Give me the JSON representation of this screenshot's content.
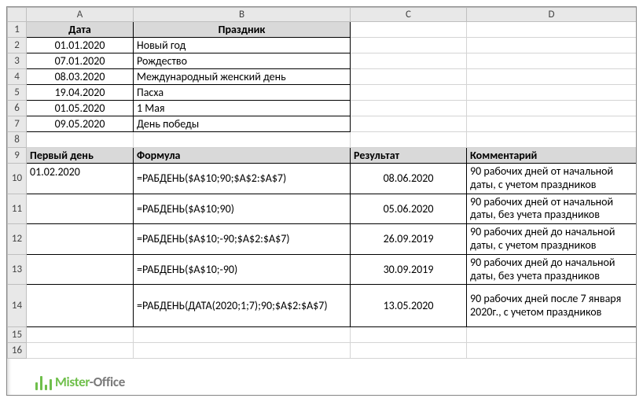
{
  "columns": [
    "A",
    "B",
    "C",
    "D"
  ],
  "rows": [
    "1",
    "2",
    "3",
    "4",
    "5",
    "6",
    "7",
    "8",
    "9",
    "10",
    "11",
    "12",
    "13",
    "14",
    "15",
    "16"
  ],
  "top_headers": {
    "A": "Дата",
    "B": "Праздник"
  },
  "holidays": [
    {
      "date": "01.01.2020",
      "name": "Новый год"
    },
    {
      "date": "07.01.2020",
      "name": "Рождество"
    },
    {
      "date": "08.03.2020",
      "name": "Международный женский день"
    },
    {
      "date": "19.04.2020",
      "name": "Пасха"
    },
    {
      "date": "01.05.2020",
      "name": "1 Мая"
    },
    {
      "date": "09.05.2020",
      "name": "День победы"
    }
  ],
  "section_headers": {
    "A": "Первый день",
    "B": "Формула",
    "C": "Результат",
    "D": "Комментарий"
  },
  "start_date": "01.02.2020",
  "examples": [
    {
      "formula": "=РАБДЕНЬ($A$10;90;$A$2:$A$7)",
      "result": "08.06.2020",
      "comment": " 90 рабочих дней от начальной даты, с учетом праздников"
    },
    {
      "formula": "=РАБДЕНЬ($A$10;90)",
      "result": "05.06.2020",
      "comment": " 90 рабочих дней от начальной даты, без учета праздников"
    },
    {
      "formula": "=РАБДЕНЬ($A$10;-90;$A$2:$A$7)",
      "result": "26.09.2019",
      "comment": " 90 рабочих дней до начальной даты, с учетом праздников"
    },
    {
      "formula": "=РАБДЕНЬ($A$10;-90)",
      "result": "30.09.2019",
      "comment": " 90 рабочих дней до начальной даты, без учета праздников"
    },
    {
      "formula": "=РАБДЕНЬ(ДАТА(2020;1;7);90;$A$2:$A$7)",
      "result": "13.05.2020",
      "comment": " 90 рабочих дней после 7 января 2020г., с учетом праздников"
    }
  ],
  "logo": {
    "left": "Mister",
    "sep": "-",
    "right": "Office"
  }
}
